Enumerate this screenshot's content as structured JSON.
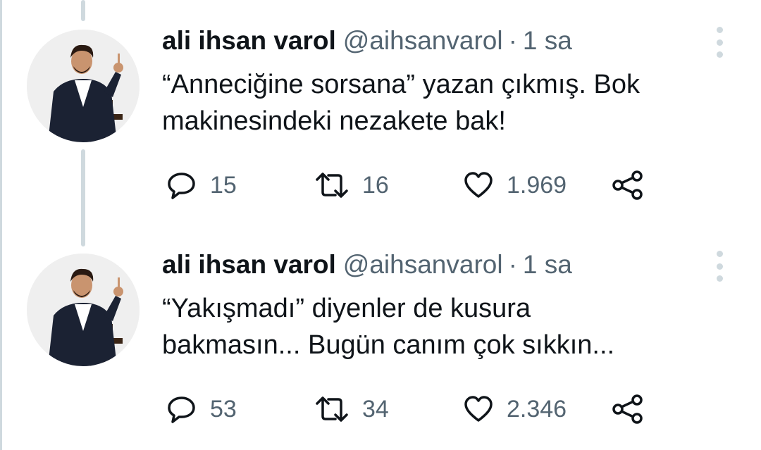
{
  "tweets": [
    {
      "author_name": "ali ihsan varol",
      "handle": "@aihsanvarol",
      "separator": "·",
      "time": "1 sa",
      "text_line1": "“Anneciğine sorsana” yazan çıkmış. Bok",
      "text_line2": "makinesindeki nezakete bak!",
      "replies": "15",
      "retweets": "16",
      "likes": "1.969"
    },
    {
      "author_name": "ali ihsan varol",
      "handle": "@aihsanvarol",
      "separator": "·",
      "time": "1 sa",
      "text_line1": "“Yakışmadı” diyenler de kusura",
      "text_line2": "bakmasın... Bugün canım çok sıkkın...",
      "replies": "53",
      "retweets": "34",
      "likes": "2.346"
    }
  ],
  "colors": {
    "text": "#0f1419",
    "secondary": "#536471",
    "thread_line": "#cfd9de"
  }
}
